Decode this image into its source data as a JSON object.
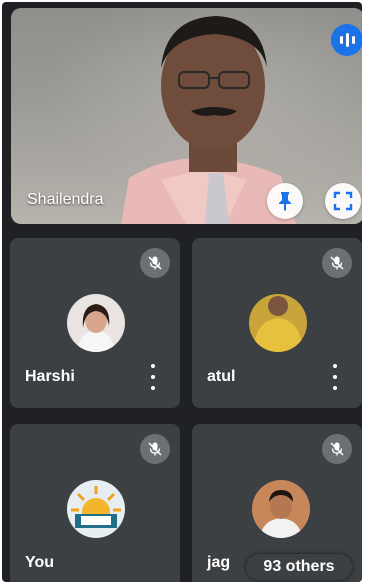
{
  "main_speaker": {
    "name": "Shailendra"
  },
  "participants": [
    {
      "name": "Harshi",
      "muted": true,
      "avatar": "woman-photo"
    },
    {
      "name": "atul",
      "muted": true,
      "avatar": "yellow-shirt-photo"
    },
    {
      "name": "You",
      "muted": true,
      "avatar": "sunrise-logo"
    },
    {
      "name": "jag",
      "muted": true,
      "avatar": "man-photo"
    }
  ],
  "others": {
    "label": "93 others"
  },
  "colors": {
    "background": "#202124",
    "tile": "#3c4043",
    "accent": "#1a73e8",
    "text": "#ffffff"
  },
  "icons": [
    "audio-wave-icon",
    "pin-icon",
    "fullscreen-icon",
    "mic-off-icon",
    "more-vert-icon"
  ]
}
